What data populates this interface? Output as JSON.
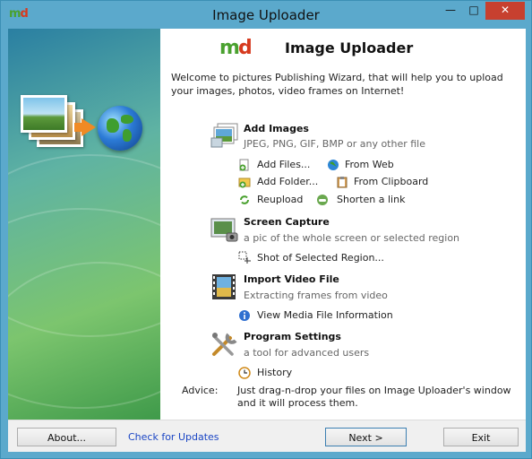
{
  "window": {
    "title": "Image Uploader",
    "logo": {
      "m": "m",
      "d": "d"
    },
    "controls": {
      "minimize": "—",
      "maximize": "□",
      "close": "✕"
    }
  },
  "header": {
    "logo_m": "m",
    "logo_d": "d",
    "title": "Image Uploader"
  },
  "welcome": "Welcome to pictures Publishing Wizard, that will help you to upload your images, photos, video frames on Internet!",
  "sections": {
    "add_images": {
      "title": "Add Images",
      "desc": "JPEG, PNG, GIF, BMP or any other file",
      "links": {
        "add_files": "Add Files...",
        "from_web": "From Web",
        "add_folder": "Add Folder...",
        "from_clipboard": "From Clipboard",
        "reupload": "Reupload",
        "shorten": "Shorten a link"
      }
    },
    "screen_capture": {
      "title": "Screen Capture",
      "desc": "a pic of the whole screen or selected region",
      "links": {
        "shot_region": "Shot of Selected Region..."
      }
    },
    "import_video": {
      "title": "Import Video File",
      "desc": "Extracting frames from video",
      "links": {
        "media_info": "View Media File Information"
      }
    },
    "program_settings": {
      "title": "Program Settings",
      "desc": "a tool for advanced users",
      "links": {
        "history": "History"
      }
    }
  },
  "advice": {
    "label": "Advice:",
    "text": "Just drag-n-drop your files on Image Uploader's window and it will process them."
  },
  "buttons": {
    "about": "About...",
    "check_updates": "Check for Updates",
    "next": "Next >",
    "exit": "Exit"
  },
  "colors": {
    "accent_link": "#1a45c4",
    "close_button": "#c7402f",
    "frame": "#5ba9cc"
  }
}
